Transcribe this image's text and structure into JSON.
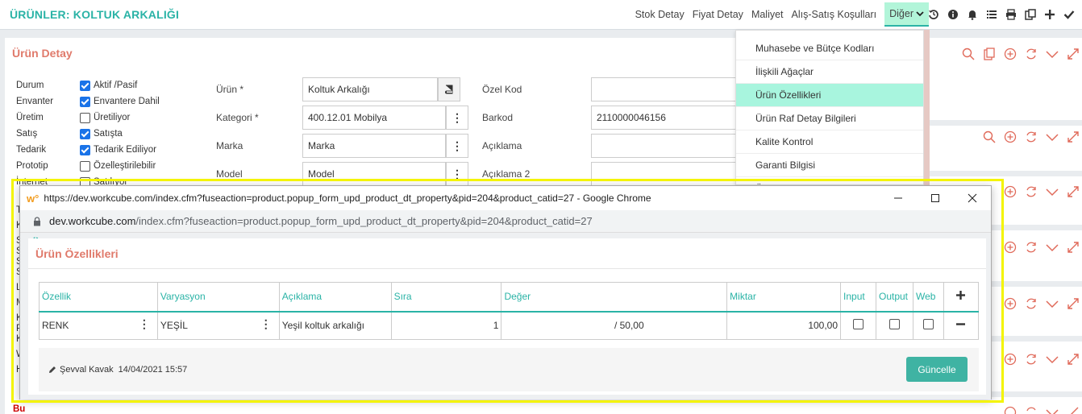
{
  "header": {
    "title": "ÜRÜNLER: KOLTUK ARKALIĞI",
    "nav": [
      "Stok Detay",
      "Fiyat Detay",
      "Maliyet",
      "Alış-Satış Koşulları"
    ],
    "active_nav": "Diğer",
    "icons": [
      "history-icon",
      "info-icon",
      "bell-icon",
      "list-icon",
      "print-icon",
      "copy-icon",
      "plus-icon",
      "check-icon"
    ]
  },
  "detail": {
    "title": "Ürün Detay",
    "flags": [
      {
        "label": "Durum",
        "value": "Aktif /Pasif",
        "checked": true
      },
      {
        "label": "Envanter",
        "value": "Envantere Dahil",
        "checked": true
      },
      {
        "label": "Üretim",
        "value": "Üretiliyor",
        "checked": false
      },
      {
        "label": "Satış",
        "value": "Satışta",
        "checked": true
      },
      {
        "label": "Tedarik",
        "value": "Tedarik Ediliyor",
        "checked": true
      },
      {
        "label": "Prototip",
        "value": "Özelleştirilebilir",
        "checked": false
      },
      {
        "label": "İnternet",
        "value": "Satılıyor",
        "checked": false
      }
    ],
    "labels": {
      "product": "Ürün *",
      "category": "Kategori *",
      "brand": "Marka",
      "model": "Model",
      "special_code": "Özel Kod",
      "barcode": "Barkod",
      "description": "Açıklama",
      "description2": "Açıklama 2"
    },
    "values": {
      "product": "Koltuk Arkalığı",
      "category": "400.12.01 Mobilya",
      "brand": "Marka",
      "model": "Model",
      "special_code": "",
      "barcode": "2110000046156",
      "description": "",
      "description2": ""
    },
    "partial_labels": [
      "Te",
      "K",
      "Sl",
      "Sl",
      "Sı",
      "Se",
      "Lo",
      "M",
      "Ka",
      "Pe",
      "Ki",
      "W",
      "H"
    ],
    "partial_red": "Bu"
  },
  "menu": {
    "items": [
      "Muhasebe ve Bütçe Kodları",
      "İlişkili Ağaçlar",
      "Ürün Özellikleri",
      "Ürün Raf Detay Bilgileri",
      "Kalite Kontrol",
      "Garanti Bilgisi",
      "Ürün Akıllı Z..."
    ],
    "highlighted": "Ürün Özellikleri"
  },
  "popup": {
    "window_title": "https://dev.workcube.com/index.cfm?fuseaction=product.popup_form_upd_product_dt_property&pid=204&product_catid=27 - Google Chrome",
    "url_host": "dev.workcube.com",
    "url_path": "/index.cfm?fuseaction=product.popup_form_upd_product_dt_property&pid=204&product_catid=27",
    "title": "Ürün Özellikleri",
    "columns": [
      "Özellik",
      "Varyasyon",
      "Açıklama",
      "Sıra",
      "Değer",
      "Miktar",
      "Input",
      "Output",
      "Web"
    ],
    "rows": [
      {
        "property": "RENK",
        "variation": "YEŞİL",
        "description": "Yeşil koltuk arkalığı",
        "order": "1",
        "value": "/  50,00",
        "quantity": "100,00",
        "input": false,
        "output": false,
        "web": false
      }
    ],
    "author": "Şevval Kavak",
    "date": "14/04/2021 15:57",
    "update_label": "Güncelle"
  },
  "colors": {
    "accent": "#2ab3a6",
    "title_red": "#e07a6b",
    "highlight_frame": "#f4f400",
    "menu_highlight": "#a8f5de",
    "icon_red": "#e06a5a"
  }
}
